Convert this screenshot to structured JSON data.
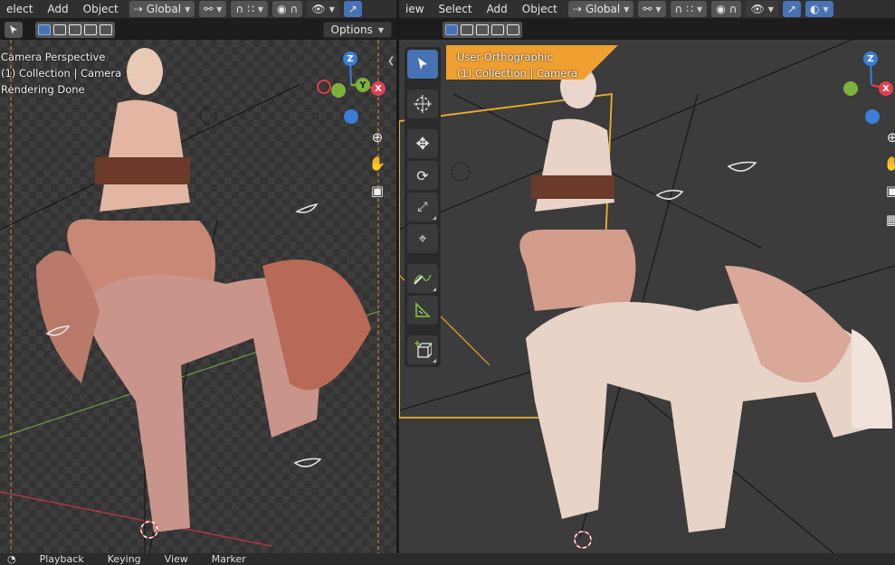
{
  "left_view": {
    "menu": [
      "elect",
      "Add",
      "Object"
    ],
    "transform_orientation": "Global",
    "options_label": "Options",
    "overlay_lines": [
      "Camera Perspective",
      "(1) Collection | Camera",
      "Rendering Done"
    ],
    "axis_labels": {
      "z": "Z",
      "y": "Y",
      "x": "X"
    }
  },
  "right_view": {
    "menu": [
      "iew",
      "Select",
      "Add",
      "Object"
    ],
    "transform_orientation": "Global",
    "overlay_lines": [
      "User Orthographic",
      "(1) Collection | Camera"
    ],
    "axis_labels": {
      "z": "Z",
      "x": "X"
    }
  },
  "bottom_bar": [
    "Playback",
    "Keying",
    "View",
    "Marker"
  ],
  "colors": {
    "x_axis": "#e0404f",
    "y_axis": "#7cb33d",
    "z_axis": "#3b7ed6",
    "accent": "#4772b3",
    "camera_select": "#f0a030"
  },
  "icons": {
    "left_header": [
      "transform-pivot-icon",
      "snap-icon",
      "proportional-editing-icon",
      "visibility-icon"
    ],
    "tools": [
      "select-box-icon",
      "cursor-icon",
      "move-icon",
      "rotate-icon",
      "scale-icon",
      "transform-icon",
      "annotate-icon",
      "measure-icon",
      "add-cube-icon"
    ]
  }
}
